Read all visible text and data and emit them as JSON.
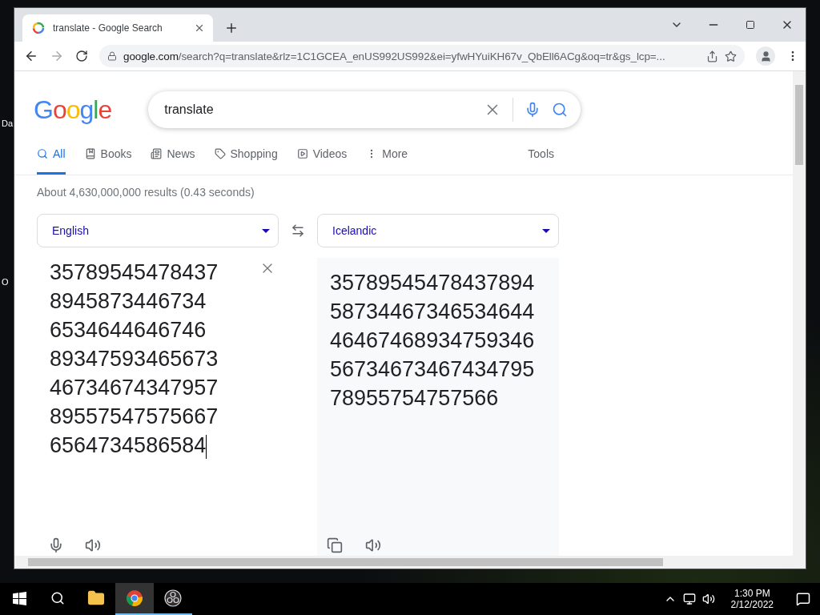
{
  "desktop_labels": [
    "Da",
    "O"
  ],
  "browser": {
    "tab": {
      "title": "translate - Google Search"
    },
    "address": {
      "host": "google.com",
      "path": "/search?q=translate&rlz=1C1GCEA_enUS992US992&ei=yfwHYuiKH67v_QbEll6ACg&oq=tr&gs_lcp=..."
    }
  },
  "page": {
    "logo": "Google",
    "search": {
      "value": "translate"
    },
    "nav": [
      {
        "label": "All",
        "kind": "all",
        "selected": true
      },
      {
        "label": "Books",
        "kind": "books",
        "selected": false
      },
      {
        "label": "News",
        "kind": "news",
        "selected": false
      },
      {
        "label": "Shopping",
        "kind": "shopping",
        "selected": false
      },
      {
        "label": "Videos",
        "kind": "videos",
        "selected": false
      },
      {
        "label": "More",
        "kind": "more",
        "selected": false
      }
    ],
    "tools": "Tools",
    "result_stats": "About 4,630,000,000 results (0.43 seconds)",
    "translator": {
      "source_language": "English",
      "target_language": "Icelandic",
      "source_lines": [
        "35789545478437",
        "8945873446734",
        "6534644646746",
        "89347593465673",
        "46734674347957",
        "89557547575667",
        "6564734586584"
      ],
      "target_lines": [
        "35789545478437894",
        "58734467346534644",
        "46467468934759346",
        "56734673467434795",
        "78955754757566"
      ]
    }
  },
  "taskbar": {
    "apps": [
      {
        "kind": "explorer",
        "active": false
      },
      {
        "kind": "chrome",
        "active": true
      },
      {
        "kind": "obs",
        "active": false
      }
    ],
    "time": "1:30 PM",
    "date": "2/12/2022"
  }
}
